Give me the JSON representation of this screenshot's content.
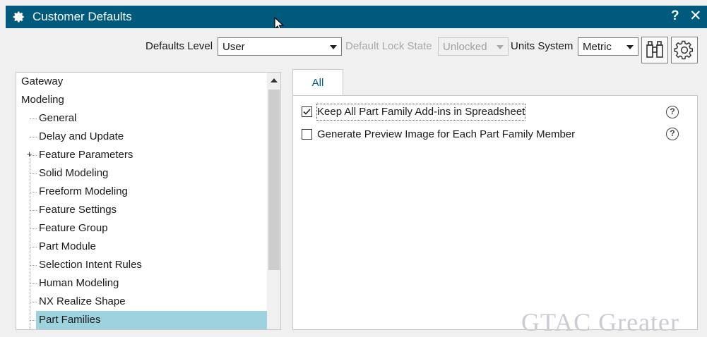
{
  "window": {
    "title": "Customer Defaults",
    "help_label": "?",
    "close_label": "✕",
    "icon": "gear-icon"
  },
  "toolbar": {
    "defaults_level_label": "Defaults Level",
    "defaults_level_value": "User",
    "lock_state_label": "Default Lock State",
    "lock_state_value": "Unlocked",
    "units_label": "Units System",
    "units_value": "Metric",
    "find_icon": "binoculars-icon",
    "settings_icon": "gear-icon"
  },
  "tree": {
    "items": [
      {
        "label": "Gateway",
        "level": 0
      },
      {
        "label": "Modeling",
        "level": 0
      },
      {
        "label": "General",
        "level": 1
      },
      {
        "label": "Delay and Update",
        "level": 1
      },
      {
        "label": "Feature Parameters",
        "level": 1,
        "expandable": true
      },
      {
        "label": "Solid Modeling",
        "level": 1
      },
      {
        "label": "Freeform Modeling",
        "level": 1
      },
      {
        "label": "Feature Settings",
        "level": 1
      },
      {
        "label": "Feature Group",
        "level": 1
      },
      {
        "label": "Part Module",
        "level": 1
      },
      {
        "label": "Selection Intent Rules",
        "level": 1
      },
      {
        "label": "Human Modeling",
        "level": 1
      },
      {
        "label": "NX Realize Shape",
        "level": 1
      },
      {
        "label": "Part Families",
        "level": 1,
        "selected": true
      }
    ]
  },
  "tabs": [
    {
      "label": "All",
      "active": true
    }
  ],
  "options": [
    {
      "label": "Keep All Part Family Add-ins in Spreadsheet",
      "checked": true
    },
    {
      "label": "Generate Preview Image for Each Part Family Member",
      "checked": false
    }
  ],
  "help_icon_label": "?",
  "watermark": "GTAC Greater"
}
